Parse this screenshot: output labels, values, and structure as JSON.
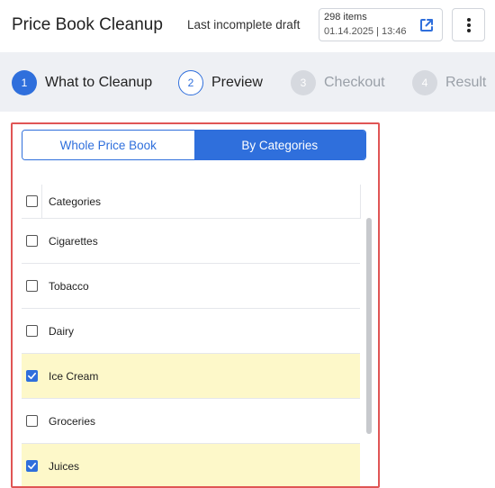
{
  "header": {
    "title": "Price Book Cleanup",
    "draft_label": "Last incomplete draft",
    "draft_count": "298 items",
    "draft_date": "01.14.2025 | 13:46",
    "open_icon": "external-link-icon",
    "menu_icon": "more-vertical-icon"
  },
  "stepper": {
    "steps": [
      {
        "num": "1",
        "label": "What to Cleanup",
        "state": "active"
      },
      {
        "num": "2",
        "label": "Preview",
        "state": "next"
      },
      {
        "num": "3",
        "label": "Checkout",
        "state": "disabled"
      },
      {
        "num": "4",
        "label": "Result",
        "state": "disabled"
      }
    ]
  },
  "panel": {
    "toggle": {
      "whole": "Whole Price Book",
      "by_categories": "By Categories",
      "selected": "By Categories"
    },
    "list_header": "Categories",
    "items": [
      {
        "label": "Cigarettes",
        "checked": false
      },
      {
        "label": "Tobacco",
        "checked": false
      },
      {
        "label": "Dairy",
        "checked": false
      },
      {
        "label": "Ice Cream",
        "checked": true
      },
      {
        "label": "Groceries",
        "checked": false
      },
      {
        "label": "Juices",
        "checked": true
      }
    ]
  },
  "colors": {
    "accent": "#2f6fdc",
    "checked_row": "#fdf8c9",
    "panel_border": "#e05555",
    "stepper_bg": "#eef0f4"
  }
}
